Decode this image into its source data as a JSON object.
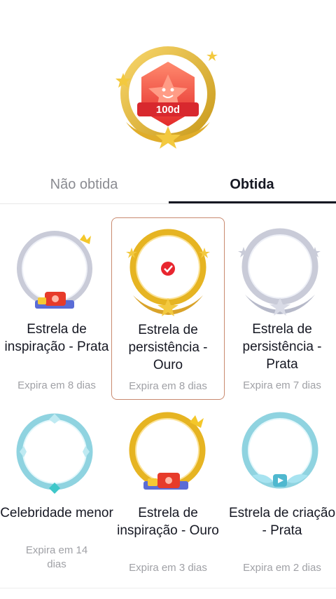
{
  "hero": {
    "badge_text": "100d"
  },
  "tabs": [
    {
      "label": "Não obtida",
      "active": false
    },
    {
      "label": "Obtida",
      "active": true
    }
  ],
  "badges": [
    {
      "name": "Estrela de inspiração - Prata",
      "expiry": "Expira em 8 dias",
      "selected": false,
      "icon": "silver-inspiration-frame-icon"
    },
    {
      "name": "Estrela de persistência - Ouro",
      "expiry": "Expira em 8 dias",
      "selected": true,
      "icon": "gold-persistence-frame-icon"
    },
    {
      "name": "Estrela de persistência - Prata",
      "expiry": "Expira em 7 dias",
      "selected": false,
      "icon": "silver-persistence-frame-icon"
    },
    {
      "name": "Celebridade menor",
      "expiry": "Expira em 14 dias",
      "selected": false,
      "icon": "blue-celebrity-frame-icon"
    },
    {
      "name": "Estrela de inspiração - Ouro",
      "expiry": "Expira em 3 dias",
      "selected": false,
      "icon": "gold-inspiration-frame-icon"
    },
    {
      "name": "Estrela de criação - Prata",
      "expiry": "Expira em 2 dias",
      "selected": false,
      "icon": "blue-creation-frame-icon"
    }
  ],
  "colors": {
    "accent_selected_border": "#c8896f",
    "check_red": "#e8262f",
    "gold": "#e6b422",
    "silver": "#c9cbd8",
    "ice_blue": "#8fd3e0"
  }
}
